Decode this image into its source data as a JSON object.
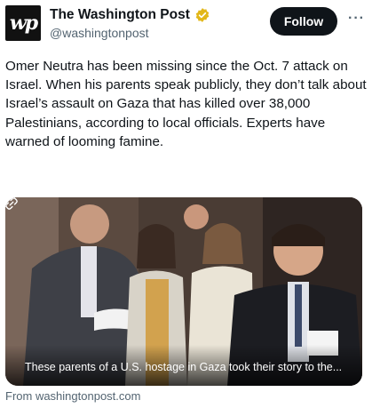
{
  "account": {
    "name": "The Washington Post",
    "handle": "@washingtonpost",
    "avatar_text": "wp",
    "verified_color": "#e2b719"
  },
  "header": {
    "follow_label": "Follow",
    "more_label": "···"
  },
  "tweet": {
    "text": "Omer Neutra has been missing since the Oct. 7 attack on Israel. When his parents speak publicly, they don’t talk about Israel’s assault on Gaza that has killed over 38,000 Palestinians, according to local officials. Experts have warned of looming famine."
  },
  "media": {
    "caption": "These parents of a U.S. hostage in Gaza took their story to the..."
  },
  "card": {
    "source": "From washingtonpost.com"
  }
}
